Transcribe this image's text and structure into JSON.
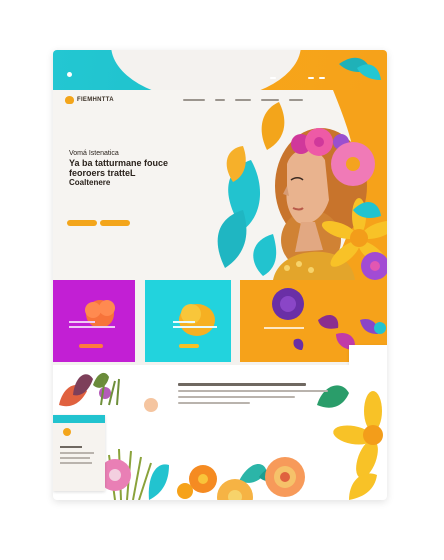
{
  "brand": {
    "name": "FIEMHNTTA"
  },
  "nav": {
    "items": [
      "",
      "",
      "",
      "",
      ""
    ]
  },
  "hero": {
    "line1": "Vomá Istenatica",
    "line2": "Ya ba tatturmane fouce",
    "line3": "feoroers tratteL",
    "line4": "Coaltenere"
  },
  "cards": [
    {
      "title": ""
    },
    {
      "title": ""
    },
    {
      "title": ""
    }
  ],
  "lower": {
    "inset_label": ""
  },
  "colors": {
    "teal": "#22d3dd",
    "orange": "#f6a21a",
    "magenta": "#c21fd4",
    "pink": "#ee5aa6"
  }
}
